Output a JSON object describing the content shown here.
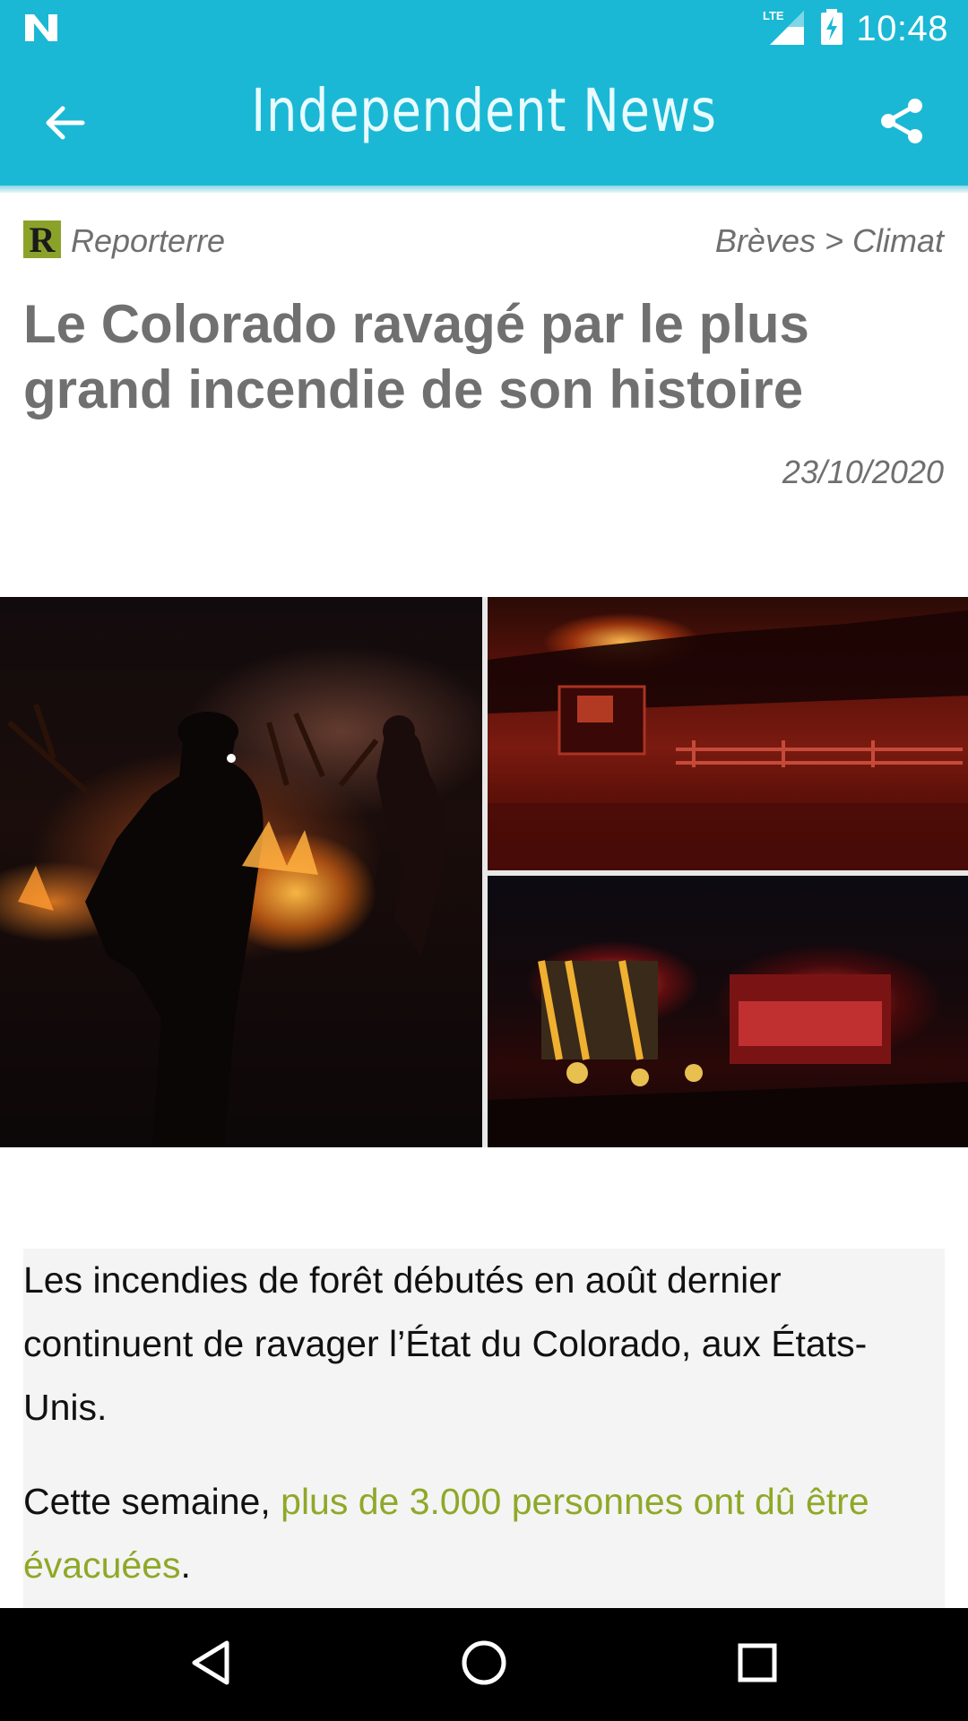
{
  "status_bar": {
    "time": "10:48",
    "network": "LTE",
    "icons": [
      "notification-n-icon",
      "signal-icon",
      "battery-charging-icon"
    ]
  },
  "app_bar": {
    "title": "Independent News",
    "back_icon": "arrow-left-icon",
    "share_icon": "share-icon",
    "color": "#1ab8d5"
  },
  "article": {
    "source": {
      "logo_letter": "R",
      "name": "Reporterre",
      "logo_color": "#8ba22a"
    },
    "breadcrumb": "Brèves > Climat",
    "title": "Le Colorado ravagé par le plus grand incendie de son histoire",
    "date": "23/10/2020",
    "paragraphs": {
      "p1": "Les incendies de forêt débutés en août dernier continuent de ravager l’État du Colorado, aux États-Unis.",
      "p2_start": "Cette semaine, ",
      "p2_link": "plus de 3.000 personnes ont dû être évacuées",
      "p2_end": "."
    },
    "link_color": "#8fa828"
  },
  "nav_bar": {
    "back": "triangle-back-icon",
    "home": "circle-home-icon",
    "recents": "square-recents-icon"
  }
}
